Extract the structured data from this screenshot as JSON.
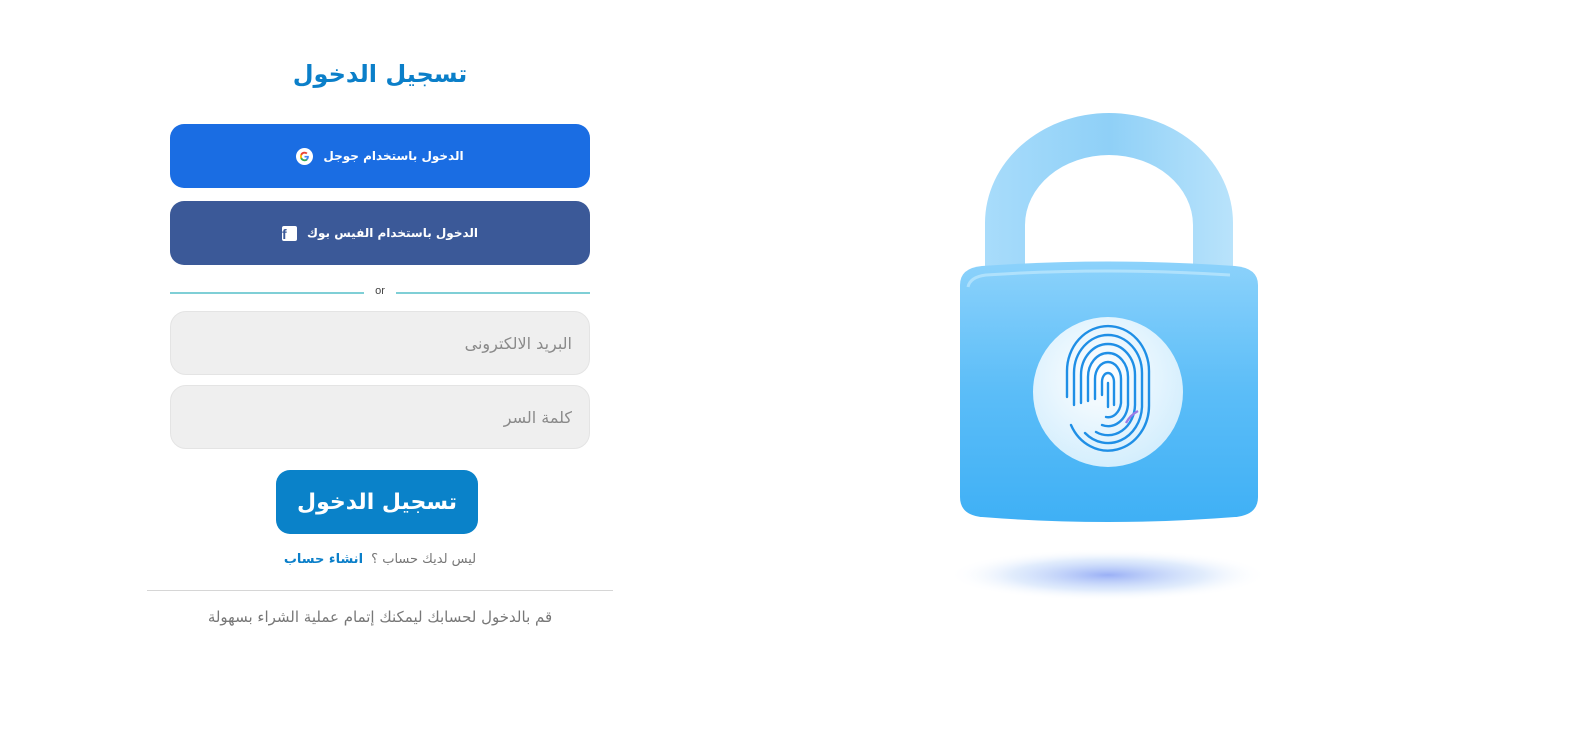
{
  "page": {
    "title": "تسجيل الدخول"
  },
  "social": {
    "google_label": "الدخول باستخدام جوجل",
    "facebook_label": "الدخول باستخدام الفيس بوك"
  },
  "divider": {
    "text": "or"
  },
  "form": {
    "email": {
      "placeholder": "البريد الالكترونى",
      "value": ""
    },
    "password": {
      "placeholder": "كلمة السر",
      "value": ""
    },
    "submit_label": "تسجيل الدخول"
  },
  "signup": {
    "question": "ليس لديك حساب ؟",
    "link_label": "انشاء حساب"
  },
  "helper_text": "قم بالدخول لحسابك ليمكنك إتمام عملية الشراء بسهولة",
  "illustration": {
    "icon": "padlock-fingerprint-icon"
  },
  "colors": {
    "accent": "#0b7fc9",
    "google_button": "#1a6de3",
    "facebook_button": "#3b5998",
    "input_background": "#efefef",
    "lock_body": "#4fb8f7"
  }
}
